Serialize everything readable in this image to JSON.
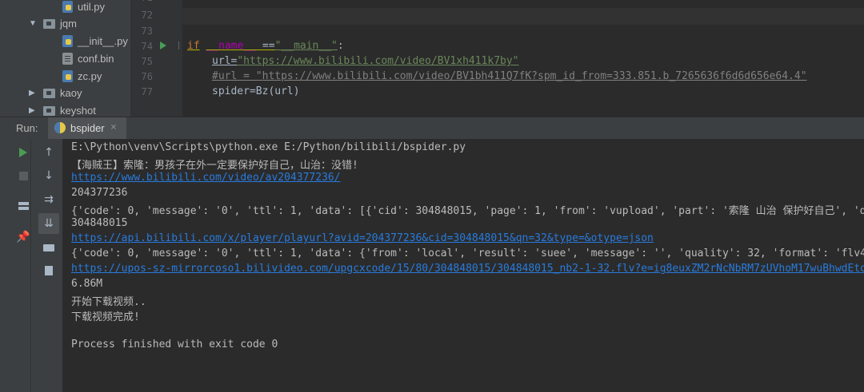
{
  "project_tree": {
    "items": [
      {
        "type": "file",
        "icon": "python-file-icon",
        "label": "util.py"
      },
      {
        "type": "folder",
        "icon": "folder-icon",
        "label": "jqm",
        "expanded": true
      },
      {
        "type": "file",
        "icon": "python-file-icon",
        "label": "__init__.py"
      },
      {
        "type": "file",
        "icon": "binary-file-icon",
        "label": "conf.bin"
      },
      {
        "type": "file",
        "icon": "python-file-icon",
        "label": "zc.py"
      },
      {
        "type": "folder",
        "icon": "folder-icon",
        "label": "kaoy",
        "expanded": false
      },
      {
        "type": "folder",
        "icon": "folder-icon",
        "label": "keyshot",
        "expanded": false
      }
    ]
  },
  "editor": {
    "line_numbers": [
      "71",
      "72",
      "73",
      "74",
      "75",
      "76",
      "77"
    ],
    "lines": {
      "l74_if": "if",
      "l74_name": "__name__",
      "l74_eq": " ==",
      "l74_main": "\"__main__\"",
      "l74_colon": ":",
      "l75_var": "url=",
      "l75_str": "\"https://www.bilibili.com/video/BV1xh411k7by\"",
      "l76_comment": "#url = \"https://www.bilibili.com/video/BV1bh411Q7fK?spm_id_from=333.851.b_7265636f6d6d656e64.4\"",
      "l77_code": "spider=Bz(url)"
    }
  },
  "run_panel": {
    "label": "Run:",
    "tab_name": "bspider",
    "close_glyph": "×"
  },
  "console": {
    "lines": [
      {
        "text": "E:\\Python\\venv\\Scripts\\python.exe E:/Python/bilibili/bspider.py",
        "link": false
      },
      {
        "text": "【海贼王】索隆：男孩子在外一定要保护好自己，山治：没错!",
        "link": false
      },
      {
        "text": "https://www.bilibili.com/video/av204377236/",
        "link": true
      },
      {
        "text": "204377236",
        "link": false
      },
      {
        "text": "{'code': 0, 'message': '0', 'ttl': 1, 'data': [{'cid': 304848015, 'page': 1, 'from': 'vupload', 'part': '索隆 山治 保护好自己', 'd",
        "link": false
      },
      {
        "text": "304848015",
        "link": false
      },
      {
        "text": "https://api.bilibili.com/x/player/playurl?avid=204377236&cid=304848015&qn=32&type=&otype=json",
        "link": true
      },
      {
        "text": "{'code': 0, 'message': '0', 'ttl': 1, 'data': {'from': 'local', 'result': 'suee', 'message': '', 'quality': 32, 'format': 'flv4",
        "link": false
      },
      {
        "text": "https://upos-sz-mirrorcoso1.bilivideo.com/upgcxcode/15/80/304848015/304848015_nb2-1-32.flv?e=ig8euxZM2rNcNbRM7zUVhoM17wuBhwdEto",
        "link": true
      },
      {
        "text": "6.86M",
        "link": false
      },
      {
        "text": "开始下载视频..",
        "link": false
      },
      {
        "text": "下载视频完成!",
        "link": false
      },
      {
        "text": "",
        "link": false
      },
      {
        "text": "Process finished with exit code 0",
        "link": false
      }
    ]
  },
  "toolbar_icons": [
    "rerun-icon",
    "scroll-up-icon",
    "stop-icon",
    "scroll-down-icon",
    "soft-wrap-icon",
    "layout-icon",
    "scroll-to-end-icon",
    "pin-icon",
    "print-icon",
    "delete-icon"
  ]
}
